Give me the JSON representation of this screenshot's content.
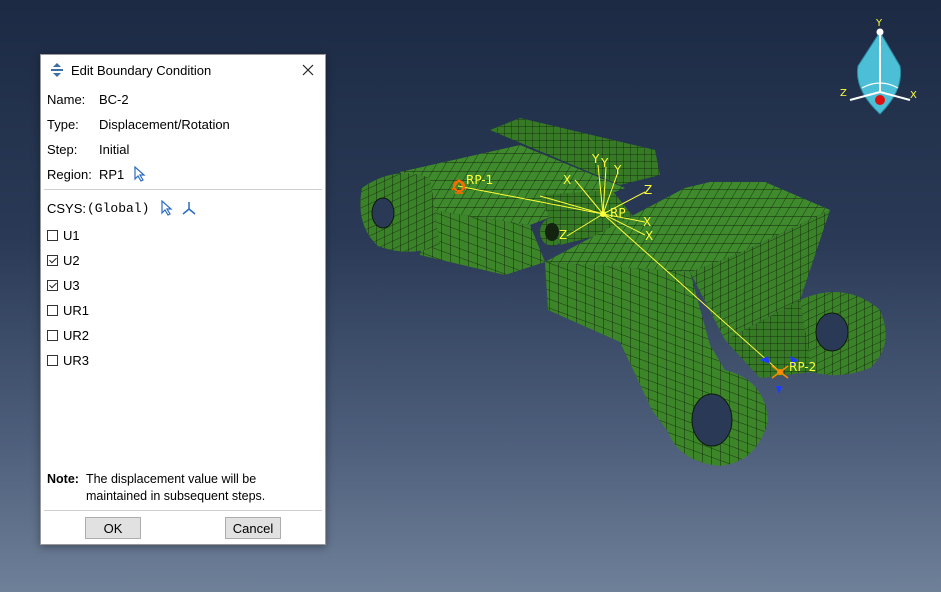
{
  "dialog": {
    "title": "Edit Boundary Condition",
    "fields": [
      {
        "key": "Name:",
        "value": "BC-2"
      },
      {
        "key": "Type:",
        "value": "Displacement/Rotation"
      },
      {
        "key": "Step:",
        "value": "Initial"
      },
      {
        "key": "Region:",
        "value": "RP1"
      }
    ],
    "csys_label": "CSYS:",
    "csys_value": "(Global)",
    "dofs": [
      {
        "label": "U1",
        "checked": false
      },
      {
        "label": "U2",
        "checked": true
      },
      {
        "label": "U3",
        "checked": true
      },
      {
        "label": "UR1",
        "checked": false
      },
      {
        "label": "UR2",
        "checked": false
      },
      {
        "label": "UR3",
        "checked": false
      }
    ],
    "note_label": "Note:",
    "note_text_1": "The displacement value will be",
    "note_text_2": "maintained in subsequent steps.",
    "ok_label": "OK",
    "cancel_label": "Cancel"
  },
  "viewport": {
    "rp1_label": "RP-1",
    "rp2_label": "RP-2",
    "rp_label": "RP",
    "axis_x": "X",
    "axis_y": "Y",
    "axis_z": "Z",
    "mesh_color": "#3f8a2c",
    "label_color": "#ffff3a"
  },
  "triad": {
    "x": "X",
    "y": "Y",
    "z": "Z"
  }
}
